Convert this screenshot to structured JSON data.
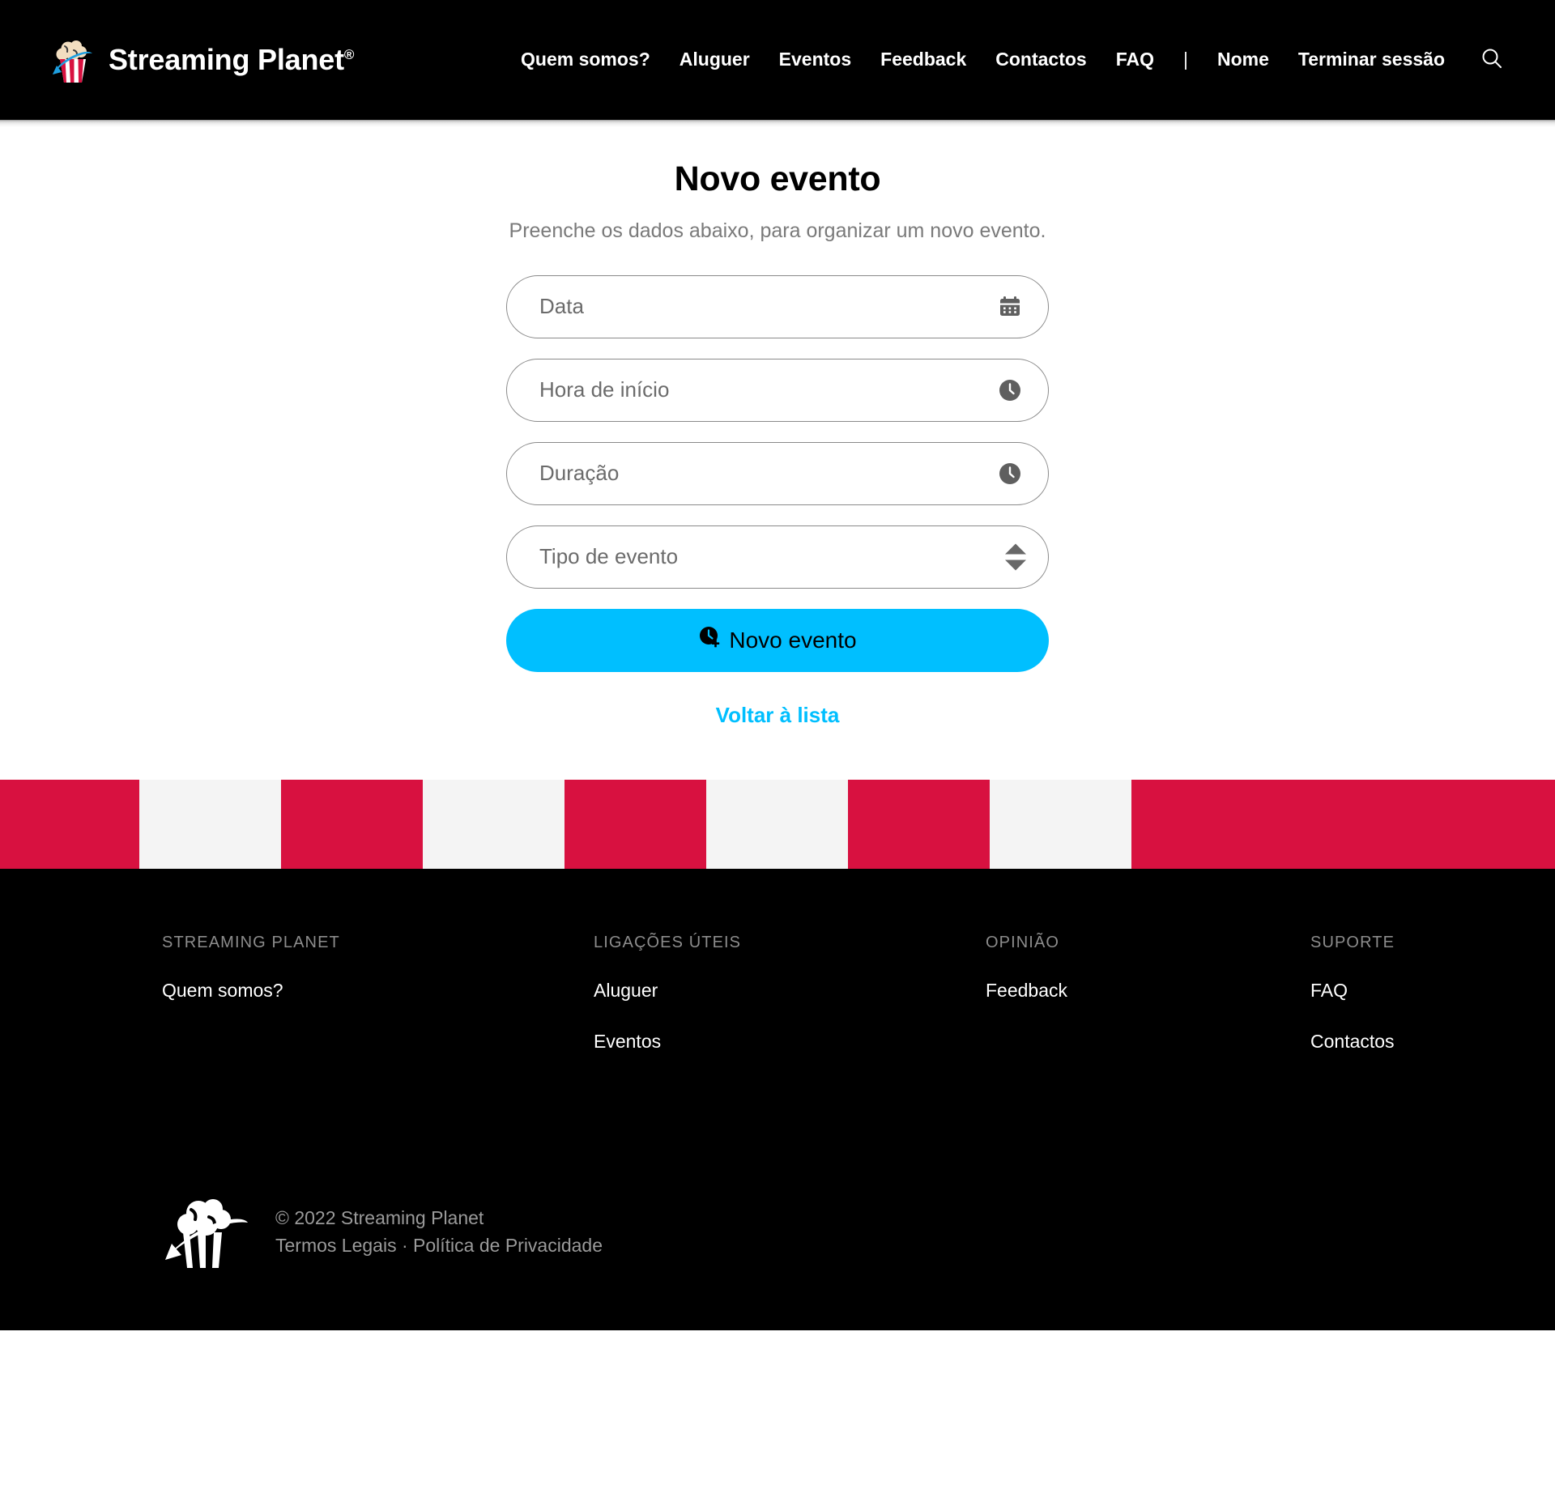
{
  "brand": {
    "name": "Streaming Planet",
    "registered_mark": "®",
    "logo_icon": "popcorn-planet-logo-icon",
    "colors": {
      "popcorn": "#F2DEC0",
      "bucket_red": "#D81140",
      "bucket_white": "#FFFFFF",
      "ring_blue": "#1E9FE0"
    }
  },
  "header": {
    "background": "#000000",
    "nav": [
      {
        "label": "Quem somos?",
        "name": "nav-quem-somos"
      },
      {
        "label": "Aluguer",
        "name": "nav-aluguer"
      },
      {
        "label": "Eventos",
        "name": "nav-eventos"
      },
      {
        "label": "Feedback",
        "name": "nav-feedback"
      },
      {
        "label": "Contactos",
        "name": "nav-contactos"
      },
      {
        "label": "FAQ",
        "name": "nav-faq"
      }
    ],
    "separator": "|",
    "account": [
      {
        "label": "Nome",
        "name": "nav-nome"
      },
      {
        "label": "Terminar sessão",
        "name": "nav-terminar-sessao"
      }
    ],
    "search_icon": "search-icon"
  },
  "main": {
    "title": "Novo evento",
    "subtitle": "Preenche os dados abaixo, para organizar um novo evento.",
    "fields": [
      {
        "placeholder": "Data",
        "value": "",
        "icon": "calendar-icon",
        "type": "date"
      },
      {
        "placeholder": "Hora de início",
        "value": "",
        "icon": "clock-icon",
        "type": "time"
      },
      {
        "placeholder": "Duração",
        "value": "",
        "icon": "clock-icon",
        "type": "duration"
      },
      {
        "placeholder": "Tipo de evento",
        "value": "",
        "icon": "stepper-arrows-icon",
        "type": "select"
      }
    ],
    "submit": {
      "label": "Novo evento",
      "icon": "clock-plus-icon",
      "background": "#00BFFF",
      "text_color": "#000000"
    },
    "back_link": {
      "label": "Voltar à lista",
      "color": "#00BFFF"
    }
  },
  "stripes": {
    "red": "#D81140",
    "white": "#F4F4F4",
    "pattern": [
      "red",
      "white",
      "red",
      "white",
      "red",
      "white",
      "red",
      "white",
      "red"
    ]
  },
  "footer": {
    "columns": [
      {
        "heading": "STREAMING PLANET",
        "links": [
          {
            "label": "Quem somos?"
          }
        ]
      },
      {
        "heading": "LIGAÇÕES ÚTEIS",
        "links": [
          {
            "label": "Aluguer"
          },
          {
            "label": "Eventos"
          }
        ]
      },
      {
        "heading": "OPINIÃO",
        "links": [
          {
            "label": "Feedback"
          }
        ]
      },
      {
        "heading": "SUPORTE",
        "links": [
          {
            "label": "FAQ"
          },
          {
            "label": "Contactos"
          }
        ]
      }
    ],
    "logo_icon": "popcorn-planet-logo-white-icon",
    "copyright": "© 2022 Streaming Planet",
    "legal": {
      "terms": "Termos Legais",
      "separator": "·",
      "privacy": "Política de Privacidade"
    }
  }
}
